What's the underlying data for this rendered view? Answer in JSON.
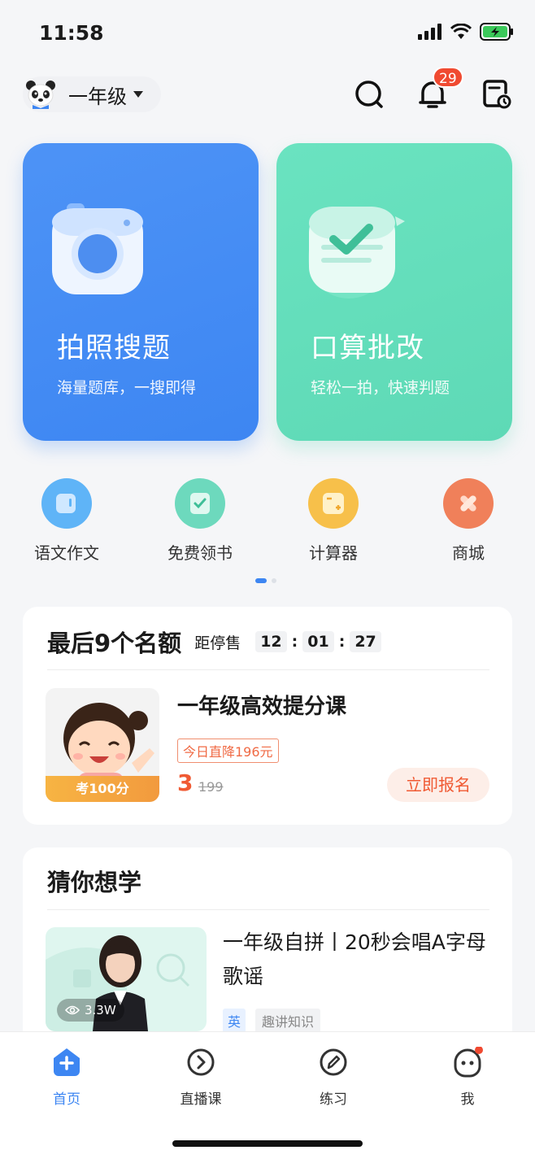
{
  "status": {
    "time": "11:58"
  },
  "header": {
    "grade": "一年级",
    "notification_count": "29"
  },
  "cards": [
    {
      "title": "拍照搜题",
      "subtitle": "海量题库，一搜即得",
      "color": "#4d93f6"
    },
    {
      "title": "口算批改",
      "subtitle": "轻松一拍，快速判题",
      "color": "#6ae3c0"
    }
  ],
  "quick_entries": [
    {
      "label": "语文作文",
      "icon": "document-icon",
      "color": "#5fb4f7"
    },
    {
      "label": "免费领书",
      "icon": "book-check-icon",
      "color": "#6dd9bd"
    },
    {
      "label": "计算器",
      "icon": "calculator-icon",
      "color": "#f7c04a"
    },
    {
      "label": "商城",
      "icon": "mall-icon",
      "color": "#f0805a"
    }
  ],
  "sale": {
    "headline": "最后9个名额",
    "stop_label": "距停售",
    "hh": "12",
    "mm": "01",
    "ss": "27",
    "course_title": "一年级高效提分课",
    "discount_tag": "今日直降196元",
    "price": "3",
    "original_price": "199",
    "ribbon": "考100分",
    "enroll": "立即报名"
  },
  "guess": {
    "heading": "猜你想学",
    "video_title": "一年级自拼丨20秒会唱A字母歌谣",
    "views": "3.3W",
    "tag_subject": "英",
    "tag_topic": "趣讲知识"
  },
  "tabs": [
    {
      "label": "首页"
    },
    {
      "label": "直播课"
    },
    {
      "label": "练习"
    },
    {
      "label": "我"
    }
  ]
}
